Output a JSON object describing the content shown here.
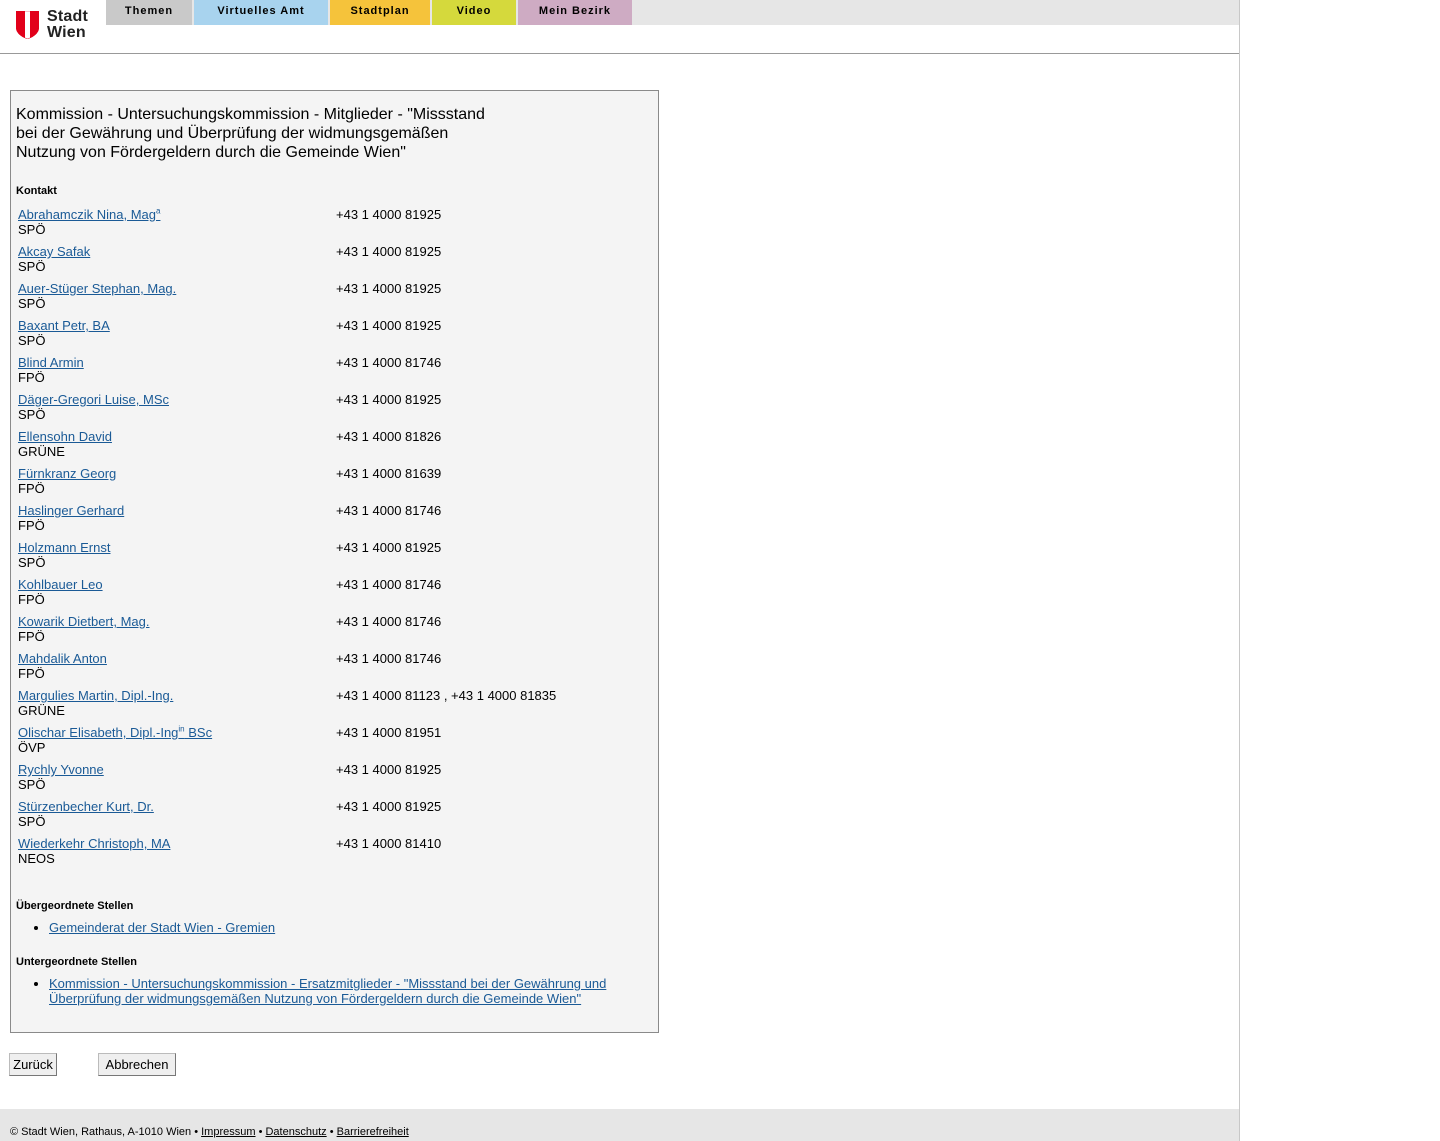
{
  "brand": {
    "line1": "Stadt",
    "line2": "Wien",
    "shield_color": "#e2001a"
  },
  "nav": {
    "items": [
      "Themen",
      "Virtuelles Amt",
      "Stadtplan",
      "Video",
      "Mein Bezirk"
    ]
  },
  "panel": {
    "title_lines": [
      "Kommission - Untersuchungskommission - Mitglieder - \"Missstand",
      "bei der Gewährung und Überprüfung der widmungsgemäßen",
      "Nutzung von Fördergeldern durch die Gemeinde Wien\""
    ],
    "contact_heading": "Kontakt",
    "members": [
      {
        "name": "Abrahamczik Nina, Mag",
        "sup": "a",
        "party": "SPÖ",
        "phone": "+43 1 4000 81925"
      },
      {
        "name": "Akcay Safak",
        "party": "SPÖ",
        "phone": "+43 1 4000 81925"
      },
      {
        "name": "Auer-Stüger Stephan, Mag.",
        "party": "SPÖ",
        "phone": "+43 1 4000 81925"
      },
      {
        "name": "Baxant Petr, BA",
        "party": "SPÖ",
        "phone": "+43 1 4000 81925"
      },
      {
        "name": "Blind Armin",
        "party": "FPÖ",
        "phone": "+43 1 4000 81746"
      },
      {
        "name": "Däger-Gregori Luise, MSc",
        "party": "SPÖ",
        "phone": "+43 1 4000 81925"
      },
      {
        "name": "Ellensohn David",
        "party": "GRÜNE",
        "phone": "+43 1 4000 81826"
      },
      {
        "name": "Fürnkranz Georg",
        "party": "FPÖ",
        "phone": "+43 1 4000 81639"
      },
      {
        "name": "Haslinger Gerhard",
        "party": "FPÖ",
        "phone": "+43 1 4000 81746"
      },
      {
        "name": "Holzmann Ernst",
        "party": "SPÖ",
        "phone": "+43 1 4000 81925"
      },
      {
        "name": "Kohlbauer Leo",
        "party": "FPÖ",
        "phone": "+43 1 4000 81746"
      },
      {
        "name": "Kowarik Dietbert, Mag.",
        "party": "FPÖ",
        "phone": "+43 1 4000 81746"
      },
      {
        "name": "Mahdalik Anton",
        "party": "FPÖ",
        "phone": "+43 1 4000 81746"
      },
      {
        "name": "Margulies Martin, Dipl.-Ing.",
        "party": "GRÜNE",
        "phone": "+43 1 4000 81123 , +43 1 4000 81835"
      },
      {
        "name": "Olischar Elisabeth, Dipl.-Ing",
        "sup": "in",
        "name_suffix": " BSc",
        "party": "ÖVP",
        "phone": "+43 1 4000 81951"
      },
      {
        "name": "Rychly Yvonne",
        "party": "SPÖ",
        "phone": "+43 1 4000 81925"
      },
      {
        "name": "Stürzenbecher Kurt, Dr.",
        "party": "SPÖ",
        "phone": "+43 1 4000 81925"
      },
      {
        "name": "Wiederkehr Christoph, MA",
        "party": "NEOS",
        "phone": "+43 1 4000 81410"
      }
    ],
    "parent_heading": "Übergeordnete Stellen",
    "parent_links": [
      "Gemeinderat der Stadt Wien - Gremien"
    ],
    "child_heading": "Untergeordnete Stellen",
    "child_links": [
      "Kommission - Untersuchungskommission - Ersatzmitglieder - \"Missstand bei der Gewährung und Überprüfung der widmungsgemäßen Nutzung von Fördergeldern durch die Gemeinde Wien\""
    ]
  },
  "buttons": {
    "back": "Zurück",
    "cancel": "Abbrechen"
  },
  "footer": {
    "copyright": "© Stadt Wien, Rathaus, A-1010 Wien",
    "sep": " • ",
    "links": [
      "Impressum",
      "Datenschutz",
      "Barrierefreiheit"
    ]
  }
}
